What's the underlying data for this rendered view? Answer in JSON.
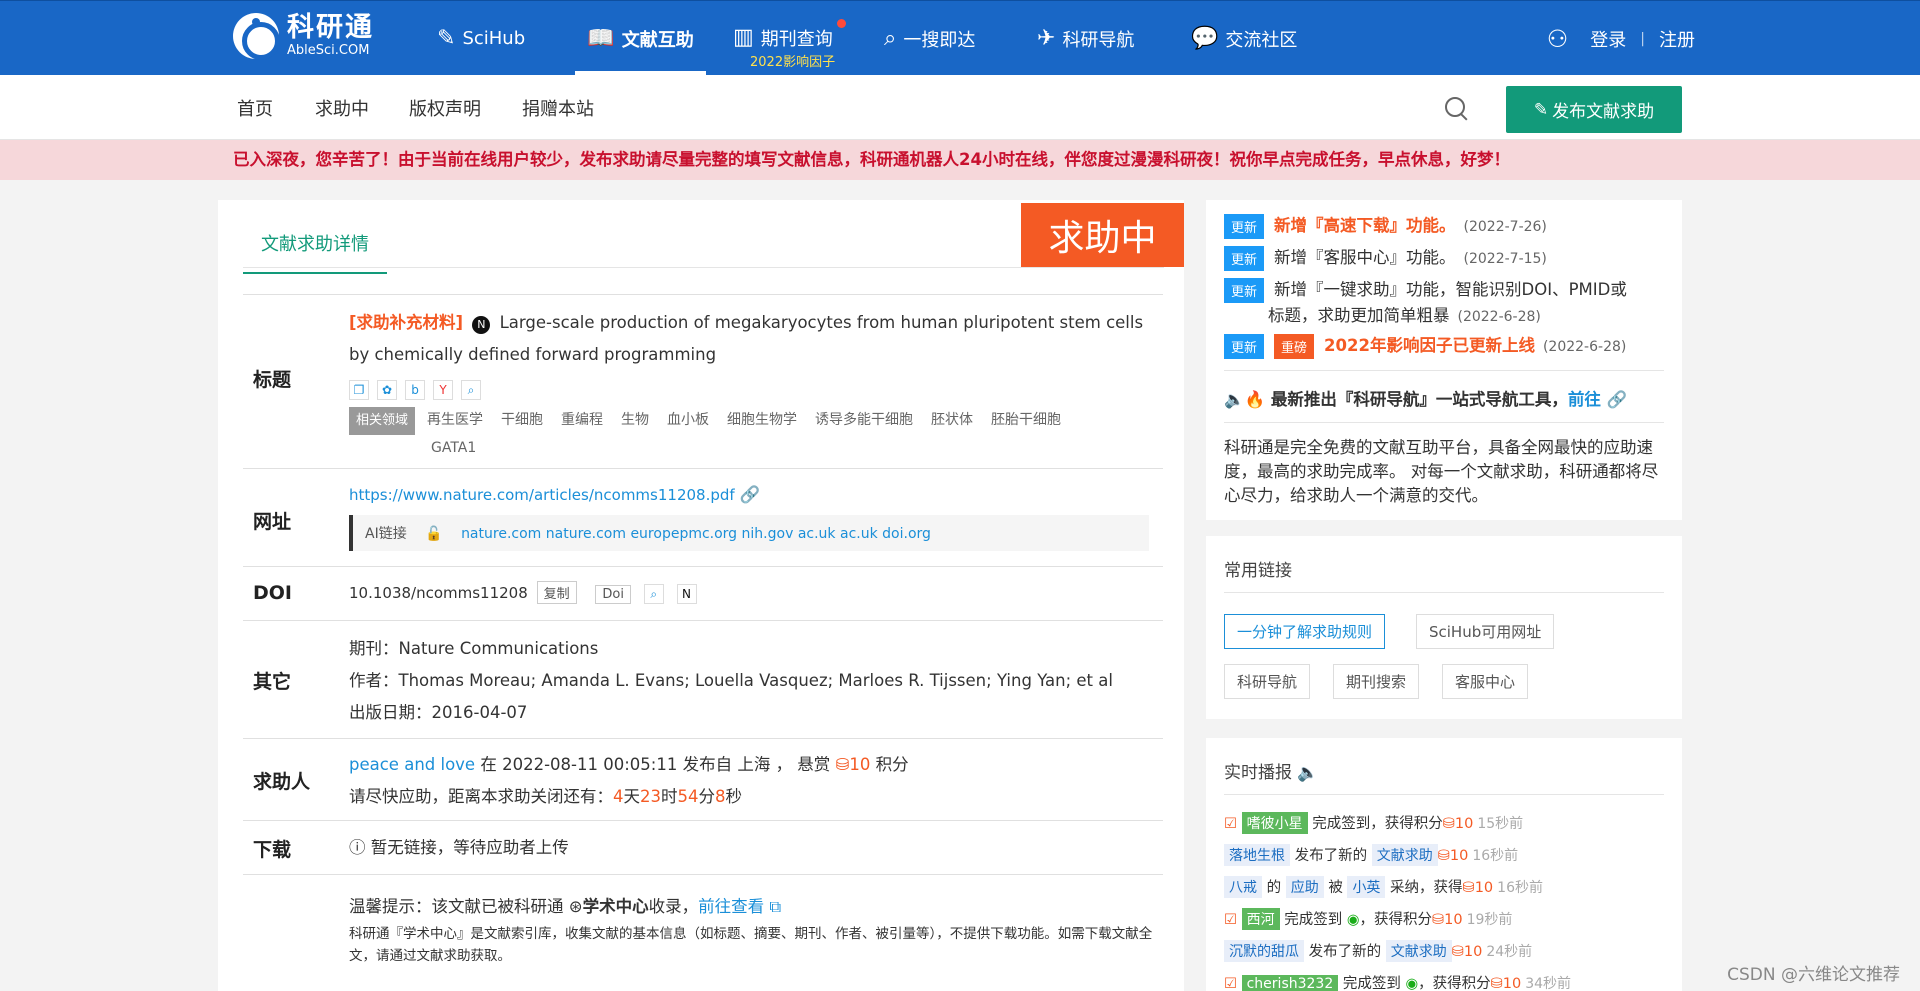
{
  "brand": {
    "name": "科研通",
    "domain": "AbleSci.COM"
  },
  "topnav": [
    {
      "label": "SciHub",
      "icon": "feather-icon"
    },
    {
      "label": "文献互助",
      "icon": "book-icon"
    },
    {
      "label": "期刊查询",
      "icon": "journal-icon"
    },
    {
      "label": "一搜即达",
      "icon": "search-icon"
    },
    {
      "label": "科研导航",
      "icon": "paper-plane-icon"
    },
    {
      "label": "交流社区",
      "icon": "chat-icon"
    }
  ],
  "topnav_sub": "2022影响因子",
  "auth": {
    "login": "登录",
    "register": "注册"
  },
  "subnav": [
    "首页",
    "求助中",
    "版权声明",
    "捐赠本站"
  ],
  "publish_button": "发布文献求助",
  "notice": "已入深夜，您辛苦了！由于当前在线用户较少，发布求助请尽量完整的填写文献信息，科研通机器人24小时在线，伴您度过漫漫科研夜！祝你早点完成任务，早点休息，好梦！",
  "detail": {
    "tab": "文献求助详情",
    "status": "求助中",
    "title_label": "标题",
    "supplement": "[求助补充材料]",
    "title": "Large-scale production of megakaryocytes from human pluripotent stem cells by chemically defined forward programming",
    "field_header": "相关领域",
    "fields": [
      "再生医学",
      "干细胞",
      "重编程",
      "生物",
      "血小板",
      "细胞生物学",
      "诱导多能干细胞",
      "胚状体",
      "胚胎干细胞",
      "GATA1"
    ],
    "url_label": "网址",
    "url": "https://www.nature.com/articles/ncomms11208.pdf",
    "ai_link": "AI链接",
    "links": [
      "nature.com",
      "nature.com",
      "europepmc.org",
      "nih.gov",
      "ac.uk",
      "ac.uk",
      "doi.org"
    ],
    "doi_label": "DOI",
    "doi": "10.1038/ncomms11208",
    "copy": "复制",
    "doi_btn": "Doi",
    "other_label": "其它",
    "journal": "期刊：Nature Communications",
    "authors": "作者：Thomas Moreau; Amanda L. Evans; Louella Vasquez; Marloes R. Tijssen; Ying Yan; et al",
    "pubdate": "出版日期：2016-04-07",
    "requester_label": "求助人",
    "requester": "peace and love",
    "req_info": "在 2022-08-11 00:05:11 发布自 上海 ， 悬赏",
    "reward": "10",
    "reward_unit": "积分",
    "countdown_prefix": "请尽快应助，距离本求助关闭还有：",
    "cd_d": "4",
    "cd_d_u": "天",
    "cd_h": "23",
    "cd_h_u": "时",
    "cd_m": "54",
    "cd_m_u": "分",
    "cd_s": "8",
    "cd_s_u": "秒",
    "download_label": "下载",
    "download_msg": "暂无链接，等待应助者上传",
    "tip_prefix": "温馨提示：该文献已被科研通",
    "tip_center": "学术中心",
    "tip_mid": "收录，",
    "tip_link": "前往查看",
    "tip_text": "科研通『学术中心』是文献索引库，收集文献的基本信息（如标题、摘要、期刊、作者、被引量等），不提供下载功能。如需下载文献全文，请通过文献求助获取。"
  },
  "updates": [
    {
      "badge": "更新",
      "text": "新增『高速下载』功能。",
      "date": "(2022-7-26)"
    },
    {
      "badge": "更新",
      "text": "新增『客服中心』功能。",
      "date": "(2022-7-15)"
    },
    {
      "badge": "更新",
      "text": "新增『一键求助』功能，智能识别DOI、PMID或",
      "text2": "标题，求助更加简单粗暴",
      "date": "(2022-6-28)"
    },
    {
      "badge": "更新",
      "badge2": "重磅",
      "text": "2022年影响因子已更新上线",
      "date": "(2022-6-28)"
    }
  ],
  "promo": {
    "text": "最新推出『科研导航』一站式导航工具，",
    "link": "前往"
  },
  "intro": "科研通是完全免费的文献互助平台，具备全网最快的应助速度，最高的求助完成率。 对每一个文献求助，科研通都将尽心尽力，给求助人一个满意的交代。",
  "common_links": {
    "title": "常用链接",
    "items": [
      "一分钟了解求助规则",
      "SciHub可用网址",
      "科研导航",
      "期刊搜索",
      "客服中心"
    ]
  },
  "live": {
    "title": "实时播报",
    "items": [
      {
        "user": "嗜彼小星",
        "action": "完成签到，获得积分",
        "pts": "10",
        "time": "15秒前"
      },
      {
        "user": "落地生根",
        "action": "发布了新的",
        "tag": "文献求助",
        "pts": "10",
        "time": "16秒前"
      },
      {
        "user": "八戒",
        "action": "的",
        "tag": "应助",
        "action2": "被",
        "user2": "小英",
        "action3": "采纳，获得",
        "pts": "10",
        "time": "16秒前"
      },
      {
        "user": "西河",
        "action": "完成签到",
        "action2": "，获得积分",
        "pts": "10",
        "time": "19秒前"
      },
      {
        "user": "沉默的甜瓜",
        "action": "发布了新的",
        "tag": "文献求助",
        "pts": "10",
        "time": "24秒前"
      },
      {
        "user": "cherish3232",
        "action": "完成签到",
        "action2": "，获得积分",
        "pts": "10",
        "time": "34秒前"
      }
    ]
  },
  "watermark": "CSDN @六维论文推荐"
}
